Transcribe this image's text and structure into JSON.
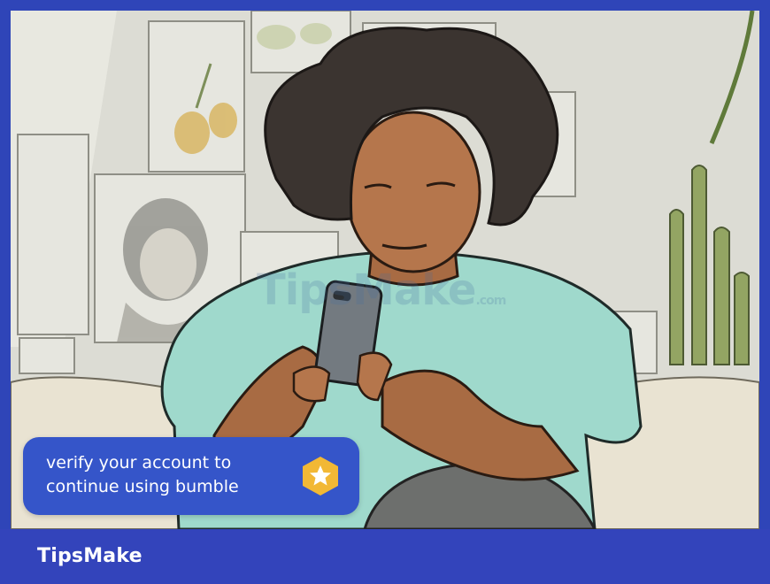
{
  "notification": {
    "text": "verify your account to\ncontinue using bumble",
    "badge_icon": "star-hexagon-icon",
    "color": "#3555c9",
    "badge_color": "#f2b835"
  },
  "watermark": {
    "text": "TipsMake",
    "suffix": ".com"
  },
  "footer": {
    "brand": "TipsMake",
    "color": "#3344bb"
  }
}
